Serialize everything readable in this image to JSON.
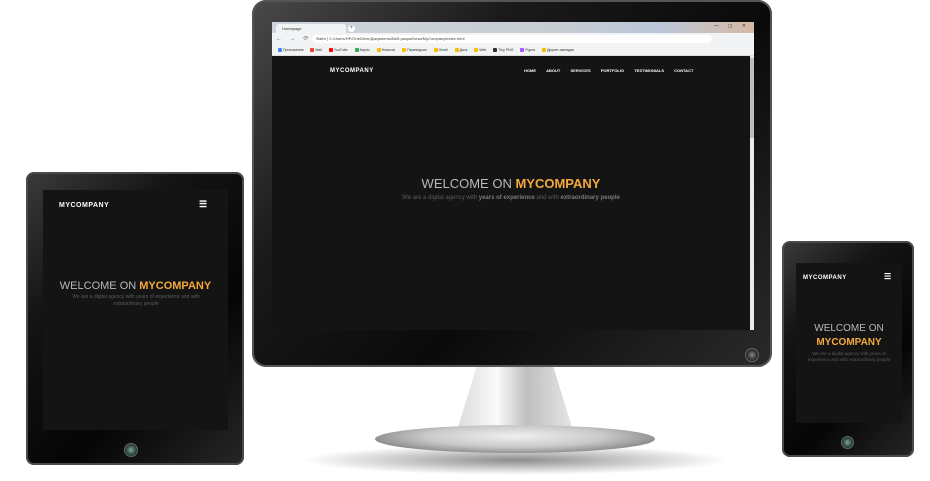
{
  "monitor": {
    "browser": {
      "tab_title": "Homepage",
      "tab_new": "+",
      "window_controls": "— ◻ ✕",
      "nav_icons": "← → ⟳ ⌂",
      "url": "Файл | C:/Users/HP/OneDrive/Документы/Веб-разработка/MyCompany/index.html",
      "bookmarks": [
        "Приложения",
        "Mail",
        "YouTube",
        "Карты",
        "Новости",
        "Переводчик",
        "Gmail",
        "Диск",
        "Web",
        "Tiny PNG",
        "Figma",
        "Другие закладки"
      ]
    },
    "site": {
      "logo": "MYCOMPANY",
      "nav": [
        "HOME",
        "ABOUT",
        "SERVICES",
        "PORTFOLIO",
        "TESTIMONIALS",
        "CONTACT"
      ],
      "welcome_prefix": "WELCOME ON",
      "brand": "MYCOMPANY",
      "subtitle_start": "We are a digital agency with",
      "subtitle_bold1": "years of experience",
      "subtitle_mid": "and with",
      "subtitle_bold2": "extraordinary people"
    }
  },
  "tablet": {
    "logo": "MYCOMPANY",
    "menu_icon": "☰",
    "welcome_prefix": "WELCOME ON",
    "brand": "MYCOMPANY",
    "subtitle": "We are a digital agency with years of experience and with extraordinary people"
  },
  "phone": {
    "logo": "MYCOMPANY",
    "menu_icon": "☰",
    "welcome_prefix": "WELCOME ON",
    "brand": "MYCOMPANY",
    "subtitle": "We are a digital agency with years of experience and with extraordinary people"
  },
  "colors": {
    "accent": "#f4a93c",
    "background": "#141414",
    "heading": "#b9b9b9"
  }
}
